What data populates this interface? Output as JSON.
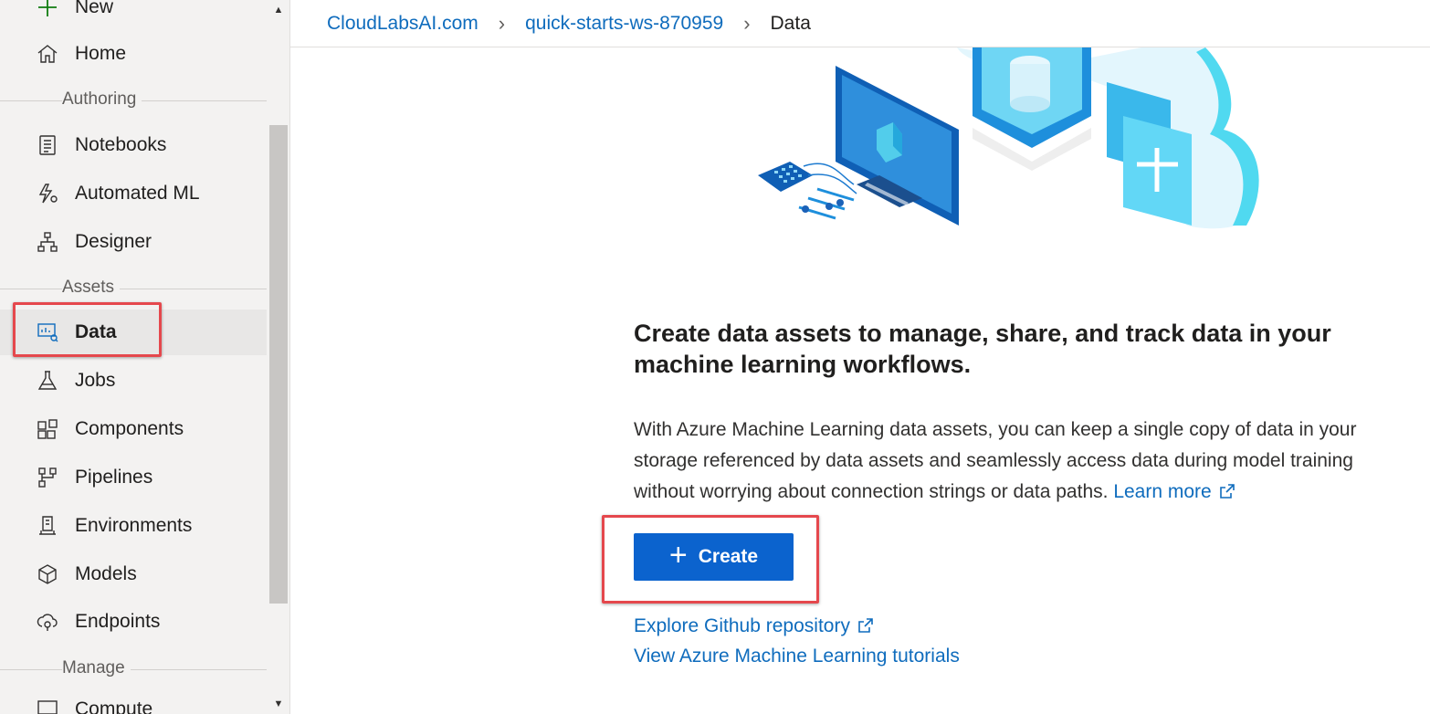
{
  "sidebar": {
    "items_top": [
      {
        "label": "New",
        "icon": "plus-icon"
      },
      {
        "label": "Home",
        "icon": "home-icon"
      }
    ],
    "sections": {
      "authoring": "Authoring",
      "assets": "Assets",
      "manage": "Manage"
    },
    "authoring_items": [
      {
        "label": "Notebooks",
        "icon": "notebook-icon"
      },
      {
        "label": "Automated ML",
        "icon": "automated-ml-icon"
      },
      {
        "label": "Designer",
        "icon": "designer-icon"
      }
    ],
    "asset_items": [
      {
        "label": "Data",
        "icon": "data-icon",
        "active": true
      },
      {
        "label": "Jobs",
        "icon": "flask-icon"
      },
      {
        "label": "Components",
        "icon": "components-icon"
      },
      {
        "label": "Pipelines",
        "icon": "pipelines-icon"
      },
      {
        "label": "Environments",
        "icon": "environments-icon"
      },
      {
        "label": "Models",
        "icon": "cube-icon"
      },
      {
        "label": "Endpoints",
        "icon": "endpoints-icon"
      }
    ],
    "manage_items": [
      {
        "label": "Compute",
        "icon": "compute-icon"
      }
    ]
  },
  "breadcrumb": {
    "root": "CloudLabsAI.com",
    "workspace": "quick-starts-ws-870959",
    "current": "Data"
  },
  "main": {
    "heading": "Create data assets to manage, share, and track data in your machine learning workflows.",
    "description": "With Azure Machine Learning data assets, you can keep a single copy of data in your storage referenced by data assets and seamlessly access data during model training without worrying about connection strings or data paths.",
    "learn_more": "Learn more",
    "create_button": "Create",
    "github_link": "Explore Github repository",
    "tutorials_link": "View Azure Machine Learning tutorials"
  },
  "colors": {
    "accent": "#0b63ce",
    "link": "#0f6cbd",
    "highlight": "#e5484d",
    "sidebar_bg": "#f3f2f1"
  }
}
